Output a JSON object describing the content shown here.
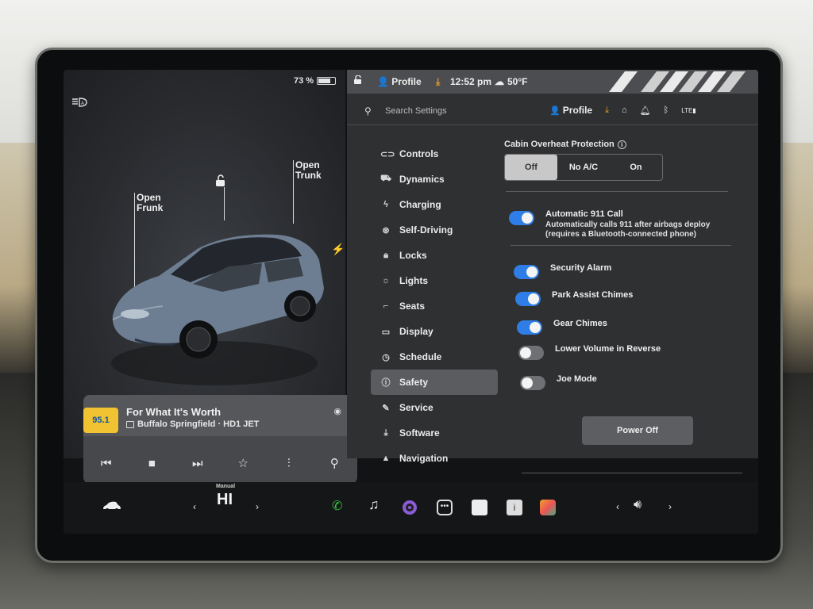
{
  "status": {
    "battery_percent": "73 %",
    "battery_level": 0.73,
    "profile": "Profile",
    "time": "12:52 pm",
    "temperature": "50°F"
  },
  "car": {
    "open_frunk": "Open\nFrunk",
    "open_trunk": "Open\nTrunk"
  },
  "media": {
    "station_logo": "95.1",
    "song_title": "For What It's Worth",
    "artist": "Buffalo Springfield · HD1 JET"
  },
  "settings": {
    "search_placeholder": "Search Settings",
    "profile_label": "Profile",
    "nav": [
      {
        "label": "Controls",
        "icon": "toggle-icon"
      },
      {
        "label": "Dynamics",
        "icon": "car-icon"
      },
      {
        "label": "Charging",
        "icon": "bolt-icon"
      },
      {
        "label": "Self-Driving",
        "icon": "steering-wheel-icon"
      },
      {
        "label": "Locks",
        "icon": "lock-icon"
      },
      {
        "label": "Lights",
        "icon": "sun-icon"
      },
      {
        "label": "Seats",
        "icon": "seat-icon"
      },
      {
        "label": "Display",
        "icon": "display-icon"
      },
      {
        "label": "Schedule",
        "icon": "clock-icon"
      },
      {
        "label": "Safety",
        "icon": "info-icon",
        "active": true
      },
      {
        "label": "Service",
        "icon": "wrench-icon"
      },
      {
        "label": "Software",
        "icon": "download-icon"
      },
      {
        "label": "Navigation",
        "icon": "navigation-icon"
      }
    ],
    "cabin_overheat": {
      "label": "Cabin Overheat Protection",
      "options": [
        "Off",
        "No A/C",
        "On"
      ],
      "selected": "Off"
    },
    "auto_911": {
      "label": "Automatic 911 Call",
      "desc": "Automatically calls 911 after airbags deploy (requires a Bluetooth-connected phone)",
      "on": true
    },
    "toggles": [
      {
        "label": "Security Alarm",
        "on": true
      },
      {
        "label": "Park Assist Chimes",
        "on": true
      },
      {
        "label": "Gear Chimes",
        "on": true
      },
      {
        "label": "Lower Volume in Reverse",
        "on": false
      },
      {
        "label": "Joe Mode",
        "on": false
      }
    ],
    "power_off": "Power Off"
  },
  "dock": {
    "climate_mode": "Manual",
    "temp": "HI"
  },
  "colors": {
    "accent": "#2f7de6",
    "background": "#2f3032"
  }
}
